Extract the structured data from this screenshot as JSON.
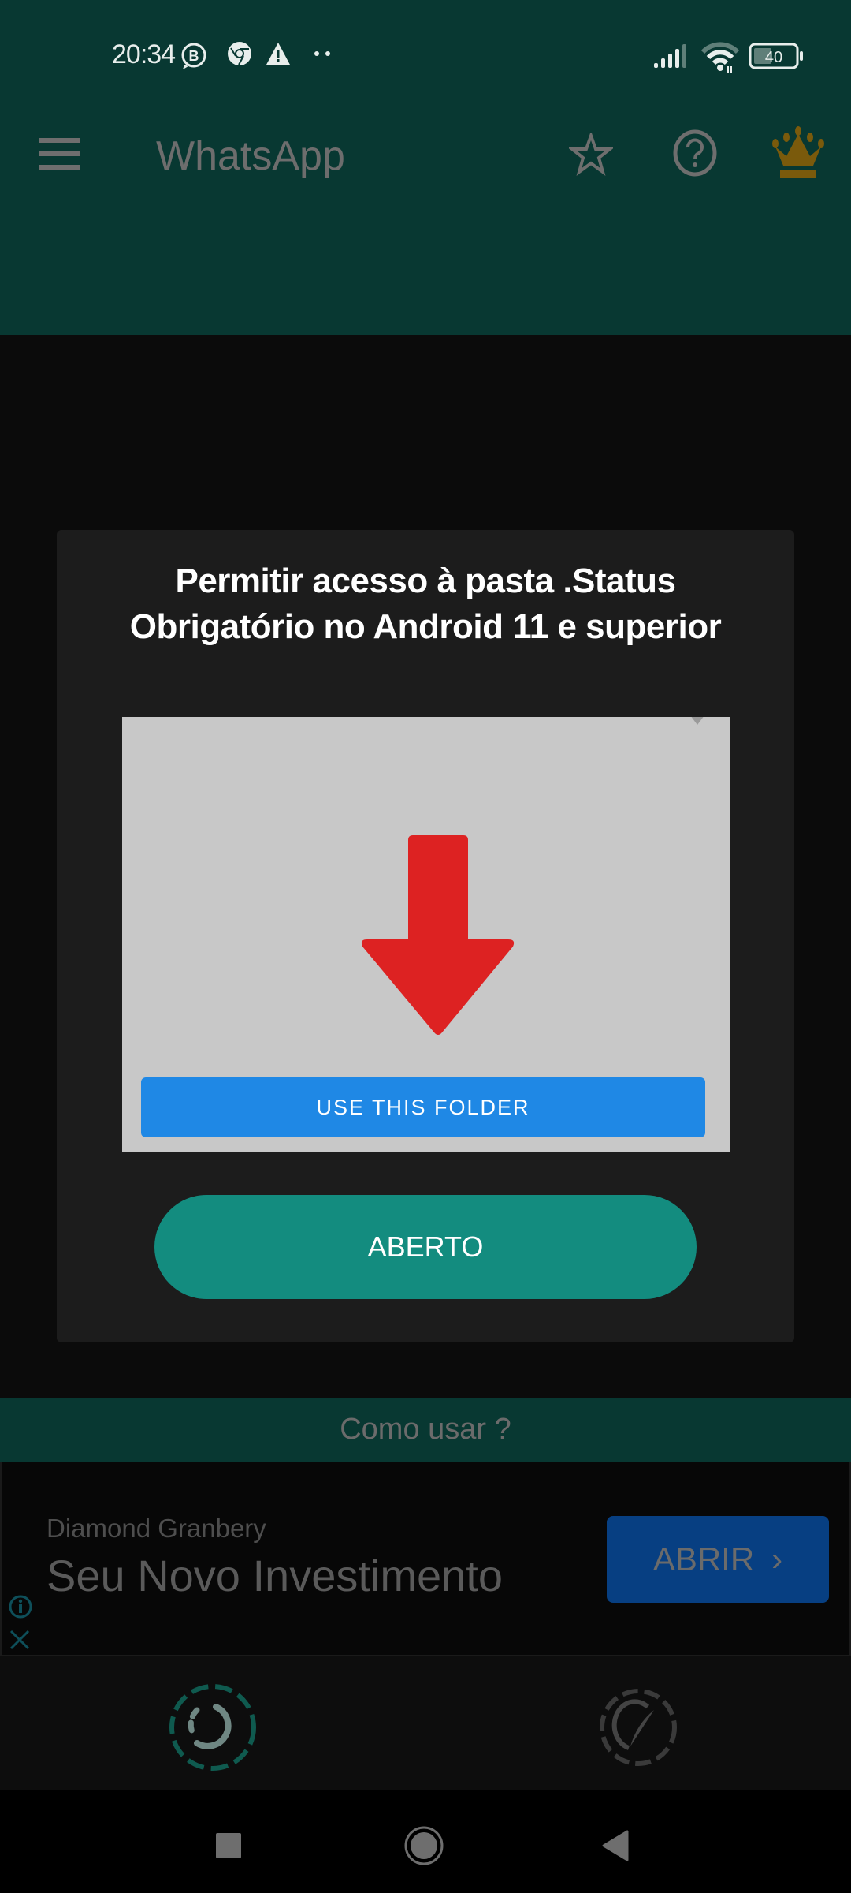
{
  "status_bar": {
    "time": "20:34",
    "left_icons": [
      "whatsapp-business-icon",
      "chrome-icon",
      "warning-icon",
      "more-notifications-icon"
    ],
    "right_icons": [
      "signal-icon",
      "wifi-icon",
      "battery-icon"
    ],
    "battery_level": "40"
  },
  "toolbar": {
    "title": "WhatsApp",
    "menu_icon": "hamburger-menu-icon",
    "actions": [
      "star-icon",
      "help-icon",
      "crown-icon"
    ]
  },
  "dialog": {
    "title_line1": "Permitir acesso à pasta .Status",
    "title_line2": "Obrigatório no Android 11 e superior",
    "image_button_label": "USE THIS FOLDER",
    "open_button_label": "ABERTO"
  },
  "howto": {
    "label": "Como usar ?"
  },
  "ad": {
    "advertiser": "Diamond Granbery",
    "headline": "Seu Novo Investimento",
    "cta_label": "ABRIR",
    "cta_chevron": "›"
  },
  "bottom_nav": {
    "items": [
      "status-icon",
      "speedometer-icon"
    ]
  },
  "system_nav": {
    "items": [
      "recents-button",
      "home-button",
      "back-button"
    ]
  },
  "colors": {
    "header_bg": "#083832",
    "dialog_bg": "#1c1c1c",
    "accent_teal": "#138c7f",
    "folder_button_blue": "#1f88e5",
    "arrow_red": "#dd2222",
    "ad_cta_blue": "#073f82",
    "crown_gold": "#7a5a0c"
  }
}
